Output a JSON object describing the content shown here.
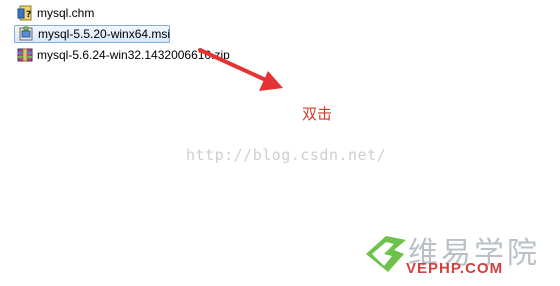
{
  "files": [
    {
      "name": "mysql.chm",
      "icon": "chm-help-icon",
      "selected": false
    },
    {
      "name": "mysql-5.5.20-winx64.msi",
      "icon": "msi-installer-icon",
      "selected": true
    },
    {
      "name": "mysql-5.6.24-win32.1432006610.zip",
      "icon": "zip-archive-icon",
      "selected": false
    }
  ],
  "annotation": {
    "text": "双击",
    "color": "#d43a2a"
  },
  "watermark": {
    "url": "http://blog.csdn.net/"
  },
  "logo": {
    "chinese": "维易学院",
    "english": "VEPHP.COM"
  }
}
